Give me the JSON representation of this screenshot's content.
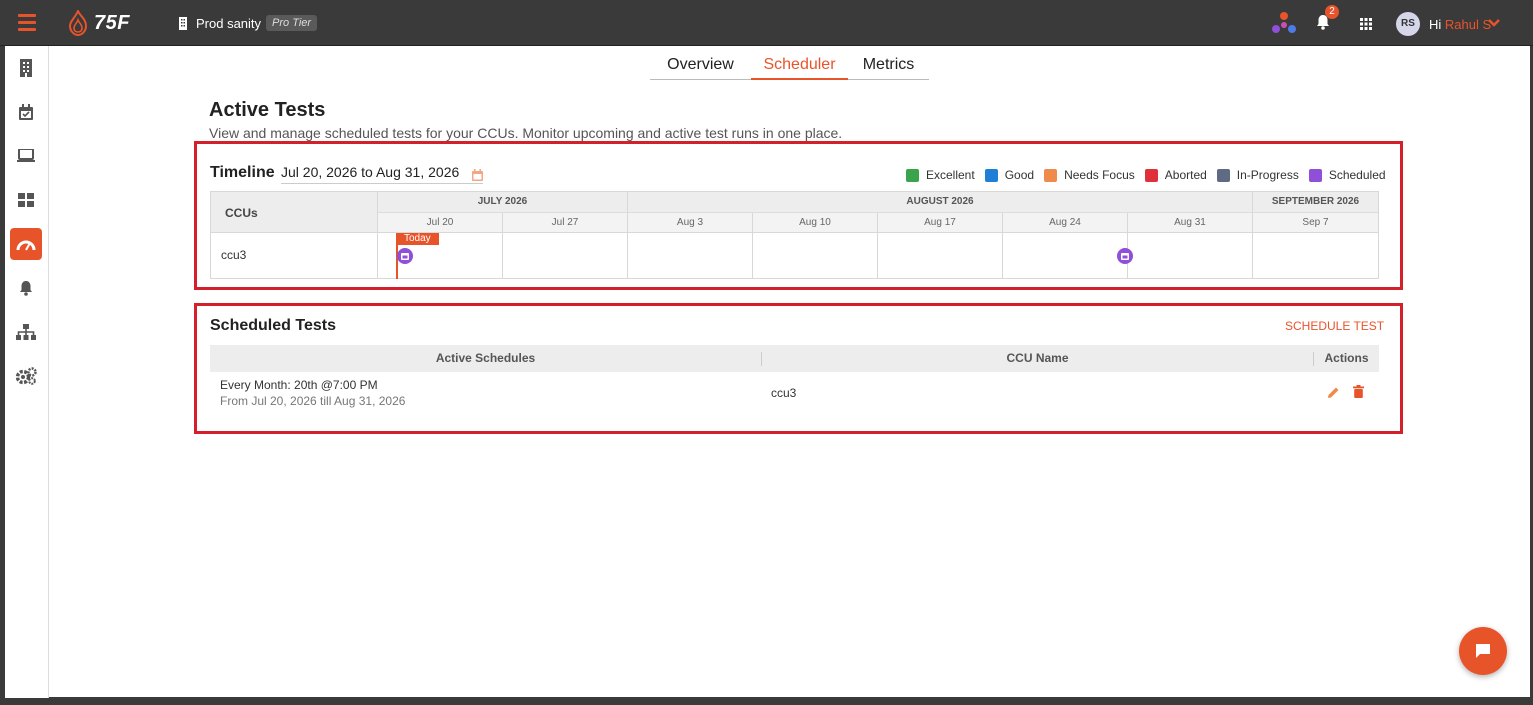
{
  "header": {
    "logo_text": "75F",
    "site_name": "Prod sanity",
    "tier": "Pro Tier",
    "notification_count": "2",
    "avatar_initials": "RS",
    "greeting": "Hi",
    "user_name": "Rahul S"
  },
  "sidebar": {
    "items": [
      {
        "name": "building-icon"
      },
      {
        "name": "calendar-check-icon"
      },
      {
        "name": "laptop-icon"
      },
      {
        "name": "dashboard-icon"
      },
      {
        "name": "gauge-icon",
        "active": true
      },
      {
        "name": "bell-icon"
      },
      {
        "name": "hierarchy-icon"
      },
      {
        "name": "settings-icon"
      }
    ]
  },
  "tabs": [
    {
      "label": "Overview"
    },
    {
      "label": "Scheduler",
      "active": true
    },
    {
      "label": "Metrics"
    }
  ],
  "page": {
    "title": "Active Tests",
    "subtitle": "View and manage scheduled tests for your CCUs. Monitor upcoming and active test runs in one place."
  },
  "timeline": {
    "label": "Timeline",
    "range": "Jul 20, 2026 to Aug 31, 2026",
    "legend": [
      {
        "label": "Excellent",
        "color": "#3aa34b"
      },
      {
        "label": "Good",
        "color": "#1f7fd6"
      },
      {
        "label": "Needs Focus",
        "color": "#f08a4b"
      },
      {
        "label": "Aborted",
        "color": "#e0303a"
      },
      {
        "label": "In-Progress",
        "color": "#5e6b82"
      },
      {
        "label": "Scheduled",
        "color": "#8f4fd8"
      }
    ],
    "ccu_header": "CCUs",
    "months": [
      "JULY 2026",
      "AUGUST 2026",
      "SEPTEMBER 2026"
    ],
    "weeks": [
      "Jul 20",
      "Jul 27",
      "Aug 3",
      "Aug 10",
      "Aug 17",
      "Aug 24",
      "Aug 31",
      "Sep 7"
    ],
    "today_label": "Today",
    "rows": [
      {
        "ccu": "ccu3"
      }
    ]
  },
  "scheduled": {
    "label": "Scheduled Tests",
    "action_label": "SCHEDULE TEST",
    "columns": [
      "Active Schedules",
      "CCU Name",
      "Actions"
    ],
    "rows": [
      {
        "schedule": "Every Month: 20th @7:00 PM",
        "period": "From Jul 20, 2026 till Aug 31, 2026",
        "ccu": "ccu3"
      }
    ]
  }
}
